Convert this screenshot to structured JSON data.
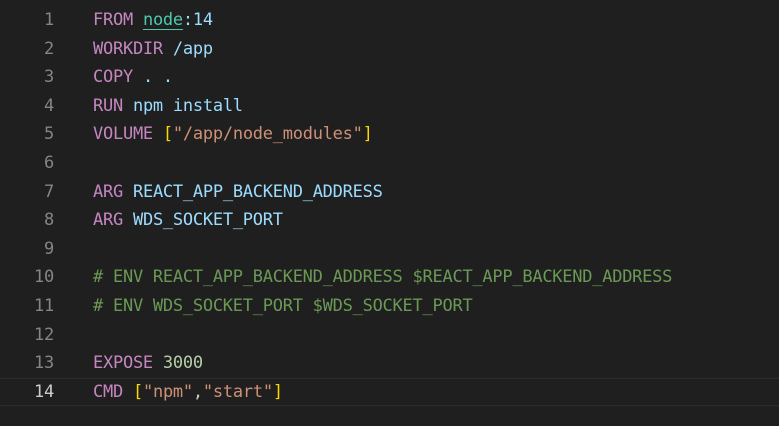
{
  "editor": {
    "current_line": "14",
    "lines": [
      {
        "number": "1",
        "tokens": [
          {
            "text": "FROM",
            "type": "keyword"
          },
          {
            "text": " ",
            "type": "plain"
          },
          {
            "text": "node",
            "type": "image"
          },
          {
            "text": ":14",
            "type": "text"
          }
        ]
      },
      {
        "number": "2",
        "tokens": [
          {
            "text": "WORKDIR",
            "type": "keyword"
          },
          {
            "text": " /app",
            "type": "text"
          }
        ]
      },
      {
        "number": "3",
        "tokens": [
          {
            "text": "COPY",
            "type": "keyword"
          },
          {
            "text": " . .",
            "type": "text"
          }
        ]
      },
      {
        "number": "4",
        "tokens": [
          {
            "text": "RUN",
            "type": "keyword"
          },
          {
            "text": " npm install",
            "type": "text"
          }
        ]
      },
      {
        "number": "5",
        "tokens": [
          {
            "text": "VOLUME",
            "type": "keyword"
          },
          {
            "text": " ",
            "type": "plain"
          },
          {
            "text": "[",
            "type": "bracket"
          },
          {
            "text": "\"/app/node_modules\"",
            "type": "string"
          },
          {
            "text": "]",
            "type": "bracket"
          }
        ]
      },
      {
        "number": "6",
        "tokens": []
      },
      {
        "number": "7",
        "tokens": [
          {
            "text": "ARG",
            "type": "keyword"
          },
          {
            "text": " ",
            "type": "plain"
          },
          {
            "text": "REACT_APP_BACKEND_ADDRESS",
            "type": "ident"
          }
        ]
      },
      {
        "number": "8",
        "tokens": [
          {
            "text": "ARG",
            "type": "keyword"
          },
          {
            "text": " ",
            "type": "plain"
          },
          {
            "text": "WDS_SOCKET_PORT",
            "type": "ident"
          }
        ]
      },
      {
        "number": "9",
        "tokens": []
      },
      {
        "number": "10",
        "tokens": [
          {
            "text": "# ENV REACT_APP_BACKEND_ADDRESS $REACT_APP_BACKEND_ADDRESS",
            "type": "comment"
          }
        ]
      },
      {
        "number": "11",
        "tokens": [
          {
            "text": "# ENV WDS_SOCKET_PORT $WDS_SOCKET_PORT",
            "type": "comment"
          }
        ]
      },
      {
        "number": "12",
        "tokens": []
      },
      {
        "number": "13",
        "tokens": [
          {
            "text": "EXPOSE",
            "type": "keyword"
          },
          {
            "text": " ",
            "type": "plain"
          },
          {
            "text": "3000",
            "type": "number"
          }
        ]
      },
      {
        "number": "14",
        "tokens": [
          {
            "text": "CMD",
            "type": "keyword"
          },
          {
            "text": " ",
            "type": "plain"
          },
          {
            "text": "[",
            "type": "bracket"
          },
          {
            "text": "\"npm\"",
            "type": "string"
          },
          {
            "text": ",",
            "type": "plain"
          },
          {
            "text": "\"start\"",
            "type": "string"
          },
          {
            "text": "]",
            "type": "bracket"
          }
        ]
      }
    ]
  },
  "colors": {
    "background": "#1f1f1f",
    "line_number": "#858585",
    "line_number_active": "#cccccc",
    "keyword": "#c586c0",
    "text": "#9cdcfe",
    "string": "#ce9178",
    "number": "#b5cea8",
    "bracket": "#ffd700",
    "comment": "#6a9955",
    "image_name": "#4ec9b0"
  }
}
